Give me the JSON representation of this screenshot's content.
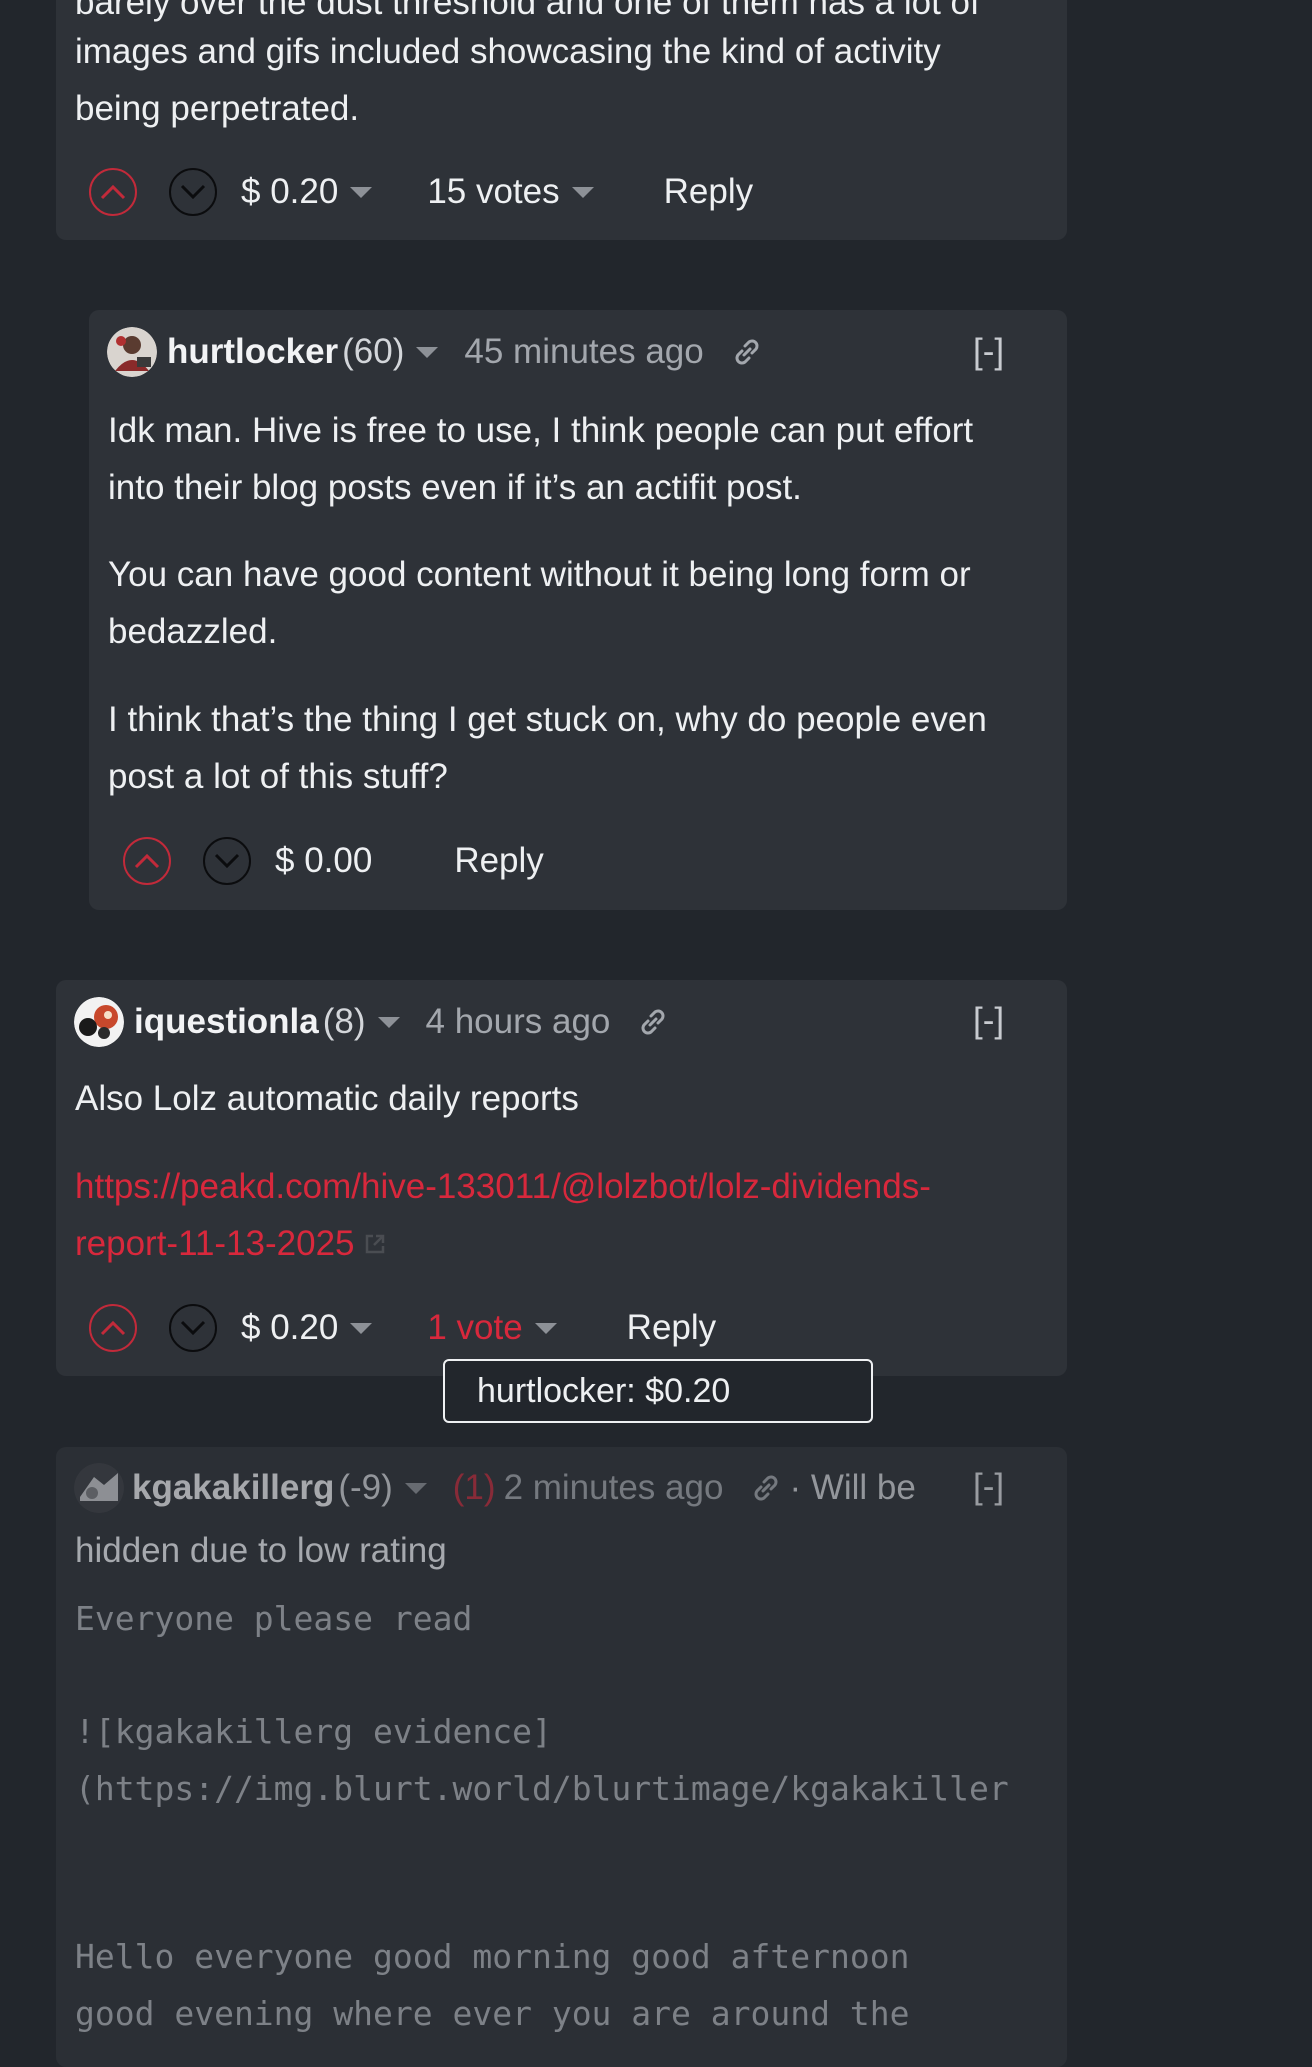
{
  "comment_top": {
    "text_lines": [
      "barely over the dust threshold and one of them has a lot of",
      "images and gifs included showcasing the kind of activity",
      "being perpetrated."
    ],
    "payout": "$ 0.20",
    "votes": "15 votes",
    "reply": "Reply"
  },
  "comment_hurtlocker": {
    "author": "hurtlocker",
    "reputation": "(60)",
    "time": "45 minutes ago",
    "collapse": "[-]",
    "p1_lines": [
      "Idk man. Hive is free to use, I think people can put effort",
      "into their blog posts even if it’s an actifit post."
    ],
    "p2_lines": [
      "You can have good content without it being long form or",
      "bedazzled."
    ],
    "p3_lines": [
      "I think that’s the thing I get stuck on, why do people even",
      "post a lot of this stuff?"
    ],
    "payout": "$ 0.00",
    "reply": "Reply"
  },
  "comment_iquestionla": {
    "author": "iquestionla",
    "reputation": "(8)",
    "time": "4 hours ago",
    "collapse": "[-]",
    "text": "Also Lolz automatic daily reports",
    "link_lines": [
      "https://peakd.com/hive-133011/@lolzbot/lolz-dividends-",
      "report-11-13-2025"
    ],
    "payout": "$ 0.20",
    "votes": "1 vote",
    "reply": "Reply",
    "tooltip": "hurtlocker: $0.20"
  },
  "comment_kgakakillerg": {
    "author": "kgakakillerg",
    "reputation": "(-9)",
    "flag_count": "(1)",
    "time": "2 minutes ago",
    "notice_a": "· Will be",
    "notice_b": "hidden due to low rating",
    "collapse": "[-]",
    "body_lines": [
      "Everyone please read",
      "",
      "![kgakakillerg evidence]",
      "(https://img.blurt.world/blurtimage/kgakakiller",
      "",
      "",
      "Hello everyone good morning good afternoon",
      "good evening where ever you are around the"
    ]
  },
  "colors": {
    "accent_red": "#d8283c",
    "background": "#22262c",
    "card": "#2e3238"
  }
}
